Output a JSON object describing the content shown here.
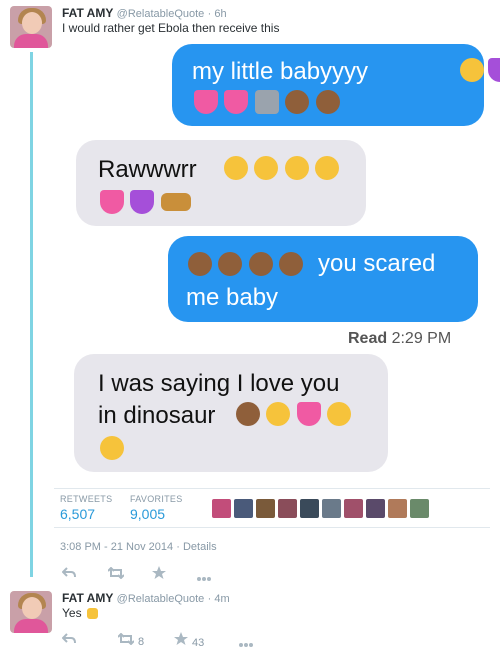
{
  "tweet": {
    "name": "FAT AMY",
    "handle": "@RelatableQuote",
    "time": "· 6h",
    "text": "I would rather get Ebola then receive this"
  },
  "messages": [
    {
      "type": "sent",
      "lines": [
        "my little babyyyy"
      ],
      "emoji": [
        "smiling-face-with-heart-eyes",
        "purple-heart",
        "growing-heart",
        "growing-heart",
        "ring",
        "see-no-evil-monkey",
        "see-no-evil-monkey"
      ]
    },
    {
      "type": "received",
      "lines": [
        "Rawwwrr"
      ],
      "emoji": [
        "smiling-face",
        "yum-face",
        "sunglasses-face",
        "smirk-face",
        "sparkling-heart",
        "purple-heart",
        "leopard"
      ]
    },
    {
      "type": "sent",
      "lines": [
        "you scared",
        "me baby"
      ],
      "emoji": [
        "see-no-evil-monkey",
        "see-no-evil-monkey",
        "see-no-evil-monkey",
        "see-no-evil-monkey"
      ]
    },
    {
      "type": "received",
      "lines": [
        "I was saying I love you",
        "in dinosaur"
      ],
      "emoji": [
        "see-no-evil-monkey",
        "heart-eyes-cat",
        "heart-with-arrow",
        "smiling-face-with-heart-eyes",
        "smiling-face"
      ]
    }
  ],
  "read_receipt": {
    "label": "Read",
    "time": "2:29 PM"
  },
  "stats": {
    "retweets_label": "RETWEETS",
    "retweets_value": "6,507",
    "favorites_label": "FAVORITES",
    "favorites_value": "9,005"
  },
  "favoriters_count": 10,
  "timestamp": {
    "time": "3:08 PM",
    "sep1": "-",
    "date": "21 Nov 2014",
    "sep2": "·",
    "details": "Details"
  },
  "actions": {
    "reply_icon": "reply-icon",
    "retweet_icon": "retweet-icon",
    "favorite_icon": "star-icon",
    "more_icon": "more-icon"
  },
  "reply": {
    "name": "FAT AMY",
    "handle": "@RelatableQuote",
    "time": "· 4m",
    "text": "Yes",
    "emoji": "raised-hands",
    "retweets": "8",
    "favorites": "43"
  },
  "colors": {
    "sent_bubble": "#2795f0",
    "received_bubble": "#e7e6ec",
    "thread_line": "#7fd4e3",
    "stat_value": "#2a9ad9"
  }
}
